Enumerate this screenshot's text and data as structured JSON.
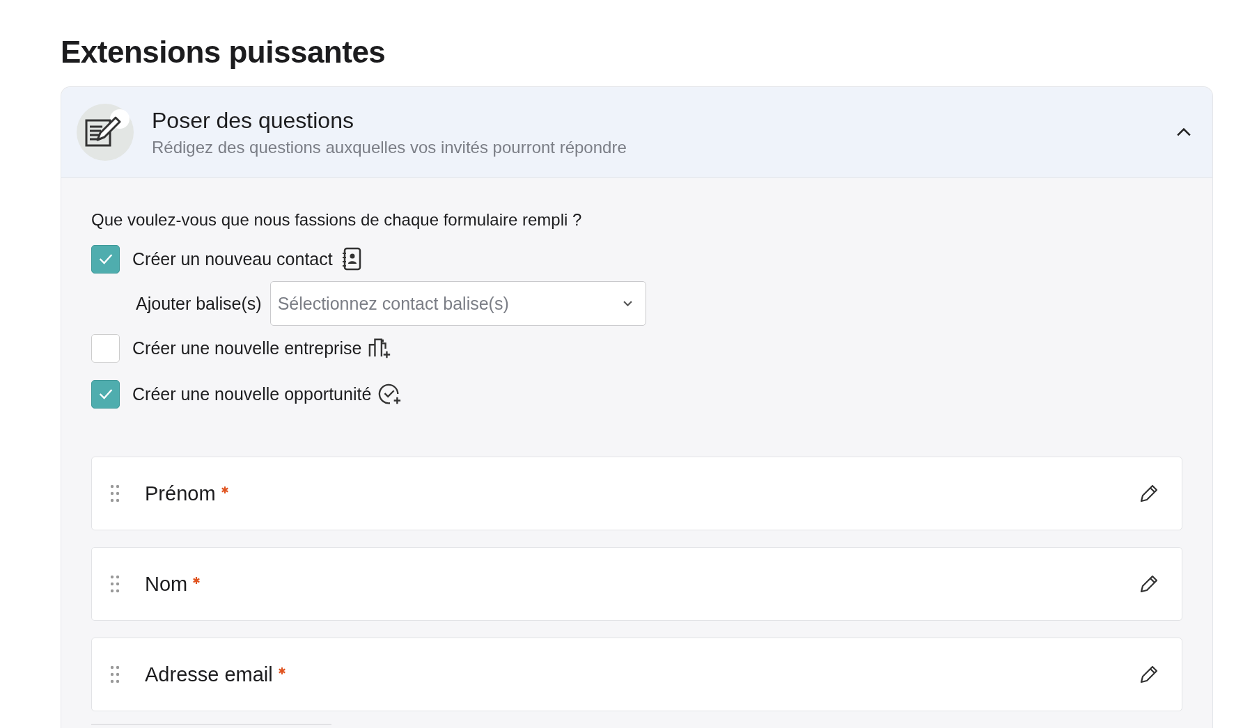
{
  "page_title": "Extensions puissantes",
  "section": {
    "title": "Poser des questions",
    "subtitle": "Rédigez des questions auxquelles vos invités pourront répondre",
    "expanded": true
  },
  "question": "Que voulez-vous que nous fassions de chaque formulaire rempli ?",
  "options": [
    {
      "kind": "contact",
      "label": "Créer un nouveau contact",
      "checked": true,
      "tag_field": {
        "label": "Ajouter balise(s)",
        "placeholder": "Sélectionnez contact balise(s)"
      }
    },
    {
      "kind": "company",
      "label": "Créer une nouvelle entreprise",
      "checked": false
    },
    {
      "kind": "deal",
      "label": "Créer une nouvelle opportunité",
      "checked": true
    }
  ],
  "fields": [
    {
      "label": "Prénom",
      "required": true
    },
    {
      "label": "Nom",
      "required": true
    },
    {
      "label": "Adresse email",
      "required": true
    }
  ]
}
